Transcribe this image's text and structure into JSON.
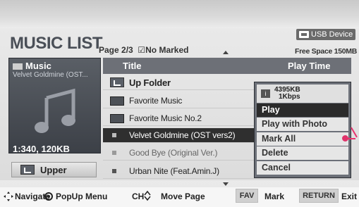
{
  "header": {
    "title": "MUSIC LIST",
    "page": "Page 2/3",
    "marked": "☑No Marked",
    "usb": "USB Device",
    "free_space": "Free Space 150MB"
  },
  "left": {
    "title": "Music",
    "subtitle": "Velvet Goldmine (OST...",
    "size": "1:340, 120KB",
    "upper": "Upper"
  },
  "list": {
    "col_title": "Title",
    "col_time": "Play Time",
    "rows": [
      "Up Folder",
      "Favorite Music",
      "Favorite Music No.2",
      "Velvet Goldmine (OST vers2)",
      "Good Bye (Original Ver.)",
      "Urban Nite (Feat.Amin.J)"
    ]
  },
  "popup": {
    "info1": "4395KB",
    "info2": "1Kbps",
    "items": [
      "Play",
      "Play with Photo",
      "Mark All",
      "Delete",
      "Cancel"
    ]
  },
  "bottom": {
    "navigate": "Navigate",
    "popup": "PopUp Menu",
    "ch": "CH",
    "move": "Move Page",
    "fav": "FAV",
    "mark": "Mark",
    "return": "RETURN",
    "exit": "Exit"
  }
}
